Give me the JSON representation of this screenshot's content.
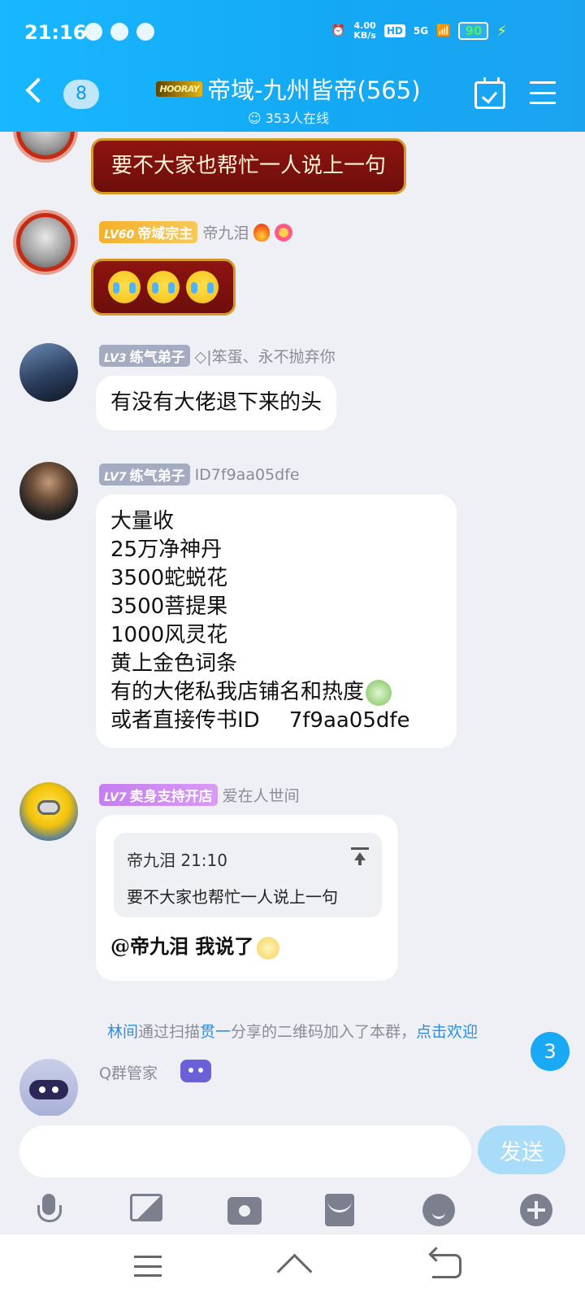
{
  "status_bar": {
    "time": "21:16",
    "speed_value": "4.00",
    "speed_unit": "KB/s",
    "hd": "HD",
    "network": "5G",
    "battery": "90"
  },
  "header": {
    "unread_count": "8",
    "badge_text": "HOORAY",
    "title": "帝域-九州皆帝(565)",
    "online": "353人在线"
  },
  "messages": [
    {
      "text": "要不大家也帮忙一人说上一句"
    },
    {
      "level": "LV60",
      "title": "帝域宗主",
      "name": "帝九泪"
    },
    {
      "level": "LV3",
      "title": "练气弟子",
      "name": "◇|笨蛋、永不抛弃你",
      "text": "有没有大佬退下来的头"
    },
    {
      "level": "LV7",
      "title": "练气弟子",
      "name": "ID7f9aa05dfe",
      "lines": [
        "大量收",
        "25万净神丹",
        "3500蛇蜕花",
        "3500菩提果",
        "1000风灵花",
        "黄上金色词条",
        "有的大佬私我店铺名和热度",
        "或者直接传书ID",
        "7f9aa05dfe"
      ]
    },
    {
      "level": "LV7",
      "title": "卖身支持开店",
      "name": "爱在人世间",
      "quote_author": "帝九泪 21:10",
      "quote_text": "要不大家也帮忙一人说上一句",
      "reply": "@帝九泪 我说了"
    }
  ],
  "system_notice": {
    "user": "林间",
    "mid1": "通过扫描",
    "inviter": "贯一",
    "mid2": "分享的二维码加入了本群，",
    "action": "点击欢迎"
  },
  "bot": {
    "name": "Q群管家"
  },
  "unread_float": "3",
  "input": {
    "placeholder": "",
    "send_label": "发送"
  },
  "colors": {
    "header": "#19b7ff",
    "accent": "#1aa9f4",
    "send_disabled": "#a9dcf8"
  }
}
